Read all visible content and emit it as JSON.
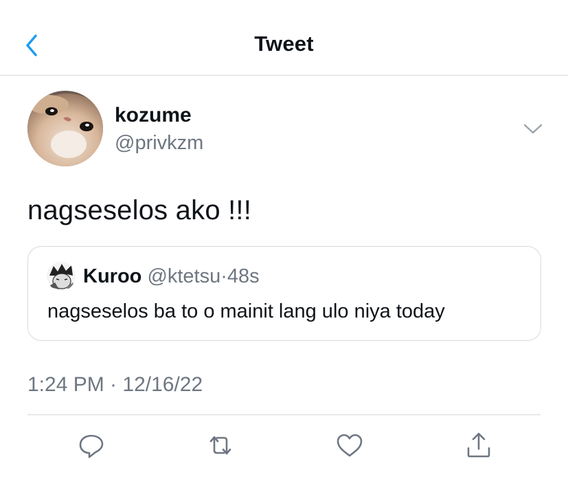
{
  "header": {
    "title": "Tweet",
    "back_icon": "chevron-left-icon"
  },
  "tweet": {
    "author": {
      "display_name": "kozume",
      "handle": "@privkzm",
      "avatar": "cat-face-avatar"
    },
    "text": "nagseselos ako !!!",
    "quoted": {
      "display_name": "Kuroo",
      "handle": "@ktetsu",
      "separator": "·",
      "age": "48s",
      "text": "nagseselos ba to o mainit lang ulo niya today"
    },
    "timestamp": "1:24 PM · 12/16/22"
  },
  "actions": [
    {
      "name": "reply",
      "icon": "reply-icon"
    },
    {
      "name": "retweet",
      "icon": "retweet-icon"
    },
    {
      "name": "like",
      "icon": "heart-icon"
    },
    {
      "name": "share",
      "icon": "share-icon"
    }
  ],
  "colors": {
    "accent": "#1d9bf0",
    "text": "#0f1419",
    "secondary_text": "#6e7681",
    "border": "#d6d9db"
  }
}
